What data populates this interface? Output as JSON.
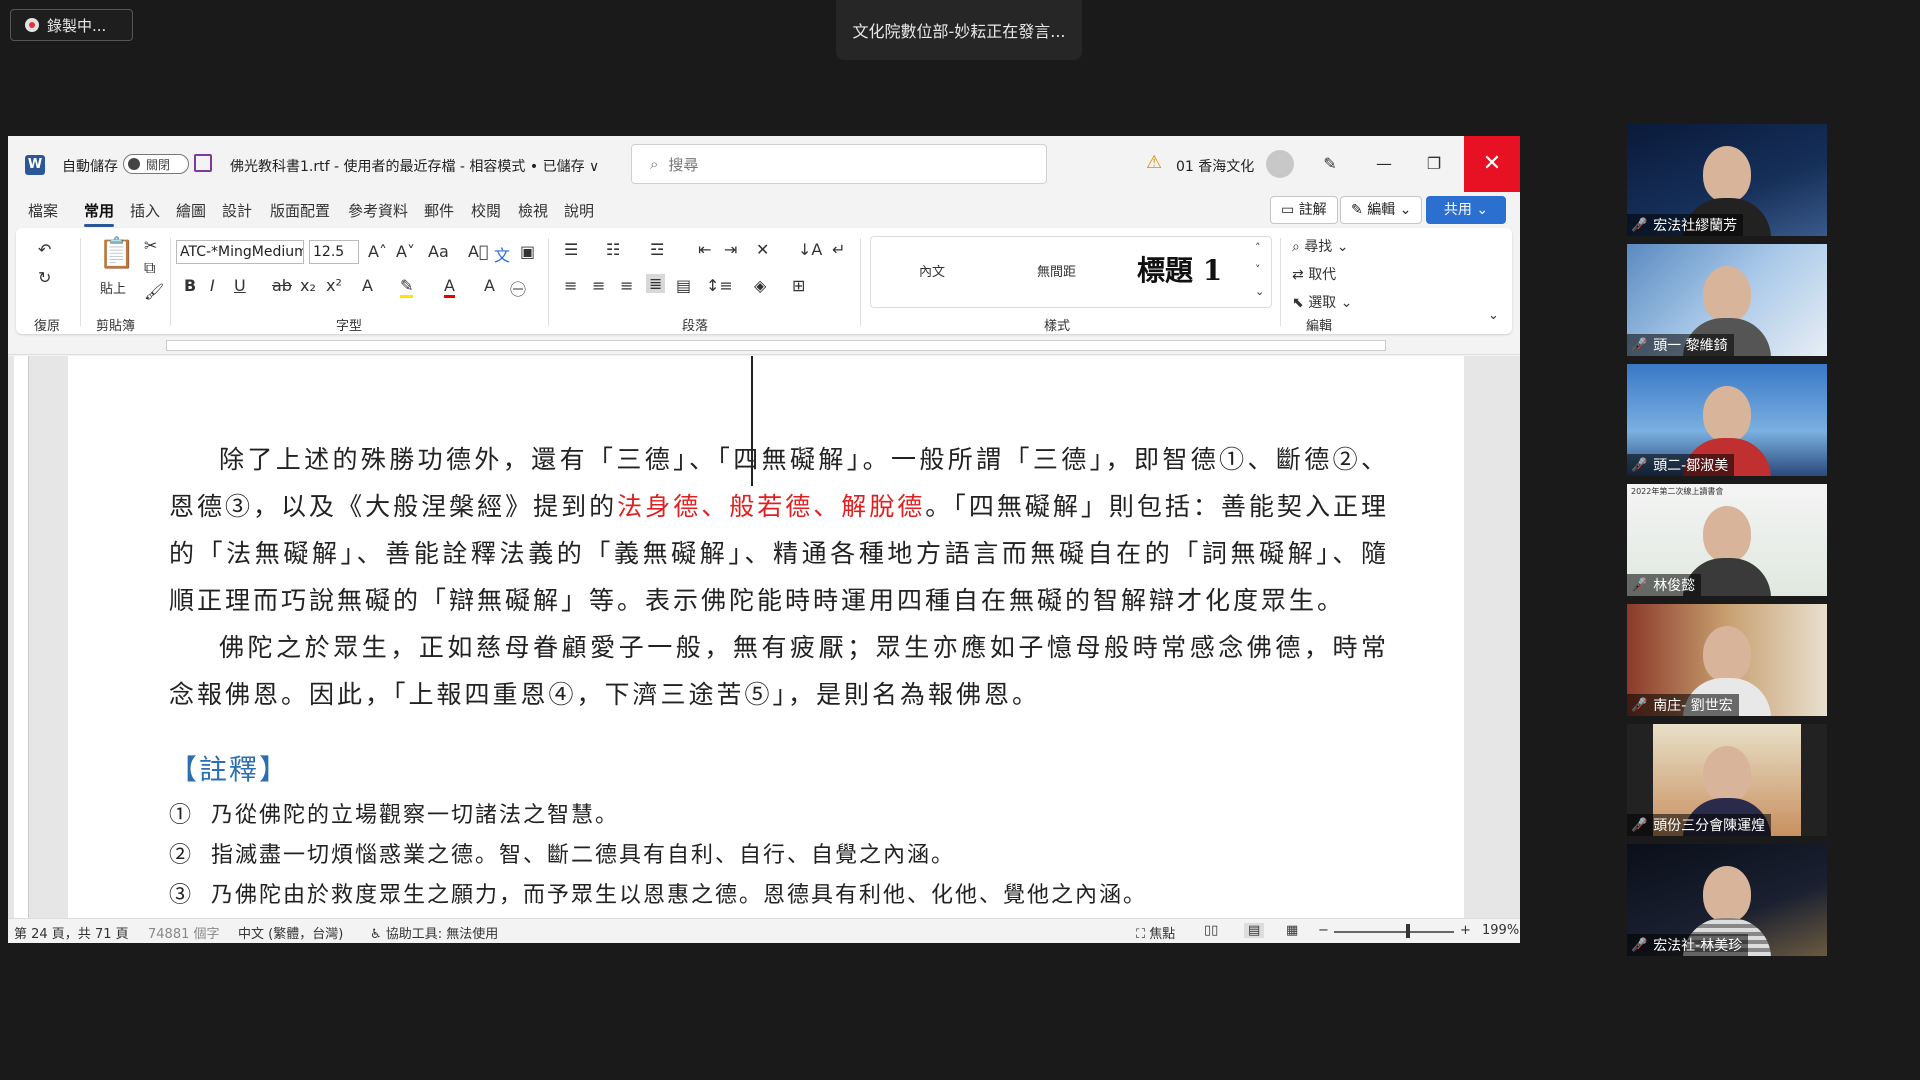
{
  "meeting": {
    "recording_label": "錄製中...",
    "speaker_label": "文化院數位部-妙耘正在發言...",
    "participants": [
      {
        "name": "宏法社繆蘭芳"
      },
      {
        "name": "頭一 黎維錡"
      },
      {
        "name": "頭二-鄒淑美"
      },
      {
        "name": "林俊懿"
      },
      {
        "name": "南庄- 劉世宏"
      },
      {
        "name": "頭份三分會陳運煌"
      },
      {
        "name": "宏法社-林美珍"
      }
    ],
    "tile4_caption": "2022年第二次線上讀書會"
  },
  "word": {
    "autosave_label": "自動儲存",
    "autosave_state": "關閉",
    "doc_title": "佛光教科書1.rtf  -  使用者的最近存檔  -  相容模式 • 已儲存 ∨",
    "search_placeholder": "搜尋",
    "account_name": "01 香海文化",
    "menu": [
      "檔案",
      "常用",
      "插入",
      "繪圖",
      "設計",
      "版面配置",
      "參考資料",
      "郵件",
      "校閱",
      "檢視",
      "說明"
    ],
    "comments_label": "註解",
    "edit_label": "編輯",
    "share_label": "共用",
    "ribbon": {
      "groups": [
        "復原",
        "剪貼簿",
        "字型",
        "段落",
        "樣式",
        "編輯"
      ],
      "paste_label": "貼上",
      "font_name": "ATC-*MingMedium",
      "font_size": "12.5",
      "styles": [
        "內文",
        "無間距",
        "標題 1"
      ],
      "find_label": "尋找",
      "replace_label": "取代",
      "select_label": "選取"
    },
    "document": {
      "para1_a": "除了上述的殊勝功德外，還有「三德」、「四無礙解」。一般所謂「三德」，即智德①、斷德②、恩德③，以及《大般涅槃經》提到的",
      "para1_red": "法身德、般若德、解脫德",
      "para1_b": "。「四無礙解」則包括：善能契入正理的「法無礙解」、善能詮釋法義的「義無礙解」、精通各種地方語言而無礙自在的「詞無礙解」、隨順正理而巧說無礙的「辯無礙解」等。表示佛陀能時時運用四種自在無礙的智解辯才化度眾生。",
      "para2": "佛陀之於眾生，正如慈母眷顧愛子一般，無有疲厭；眾生亦應如子憶母般時常感念佛德，時常念報佛恩。因此，「上報四重恩④，下濟三途苦⑤」，是則名為報佛恩。",
      "notes_heading": "【註釋】",
      "notes": [
        {
          "num": "①",
          "text": "乃從佛陀的立場觀察一切諸法之智慧。"
        },
        {
          "num": "②",
          "text": "指滅盡一切煩惱惑業之德。智、斷二德具有自利、自行、自覺之內涵。"
        },
        {
          "num": "③",
          "text": "乃佛陀由於救度眾生之願力，而予眾生以恩惠之德。恩德具有利他、化他、覺他之內涵。"
        }
      ]
    },
    "status": {
      "page": "第 24 頁，共 71 頁",
      "words": "74881 個字",
      "language": "中文 (繁體，台灣)",
      "accessibility": "協助工具: 無法使用",
      "focus": "焦點",
      "zoom": "199%"
    }
  }
}
